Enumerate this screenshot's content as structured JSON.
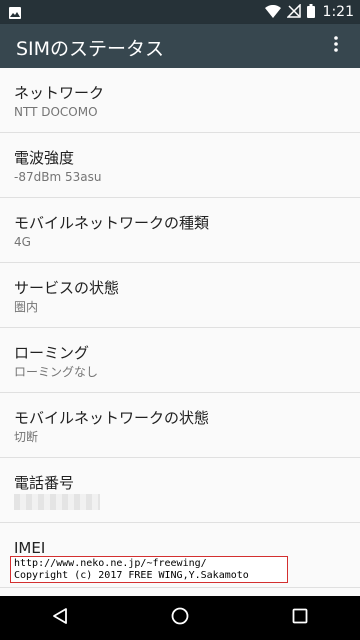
{
  "status_bar": {
    "time": "1:21",
    "icons": [
      "image-icon",
      "wifi-icon",
      "no-signal-icon",
      "battery-icon"
    ]
  },
  "app_bar": {
    "title": "SIMのステータス",
    "overflow_icon": "more-vert-icon"
  },
  "items": [
    {
      "label": "ネットワーク",
      "value": "NTT DOCOMO"
    },
    {
      "label": "電波強度",
      "value": "-87dBm 53asu"
    },
    {
      "label": "モバイルネットワークの種類",
      "value": "4G"
    },
    {
      "label": "サービスの状態",
      "value": "圏内"
    },
    {
      "label": "ローミング",
      "value": "ローミングなし"
    },
    {
      "label": "モバイルネットワークの状態",
      "value": "切断"
    },
    {
      "label": "電話番号",
      "value": ""
    },
    {
      "label": "IMEI",
      "value": ""
    }
  ],
  "watermark": {
    "line1": "http://www.neko.ne.jp/~freewing/",
    "line2": "Copyright (c) 2017 FREE WING,Y.Sakamoto"
  },
  "nav_bar": {
    "icons": [
      "back-icon",
      "home-icon",
      "recents-icon"
    ]
  },
  "colors": {
    "status_bar": "#263238",
    "app_bar": "#37474f",
    "background": "#fafafa",
    "primary_text": "#212121",
    "secondary_text": "#757575",
    "watermark_border": "#d32f2f"
  }
}
